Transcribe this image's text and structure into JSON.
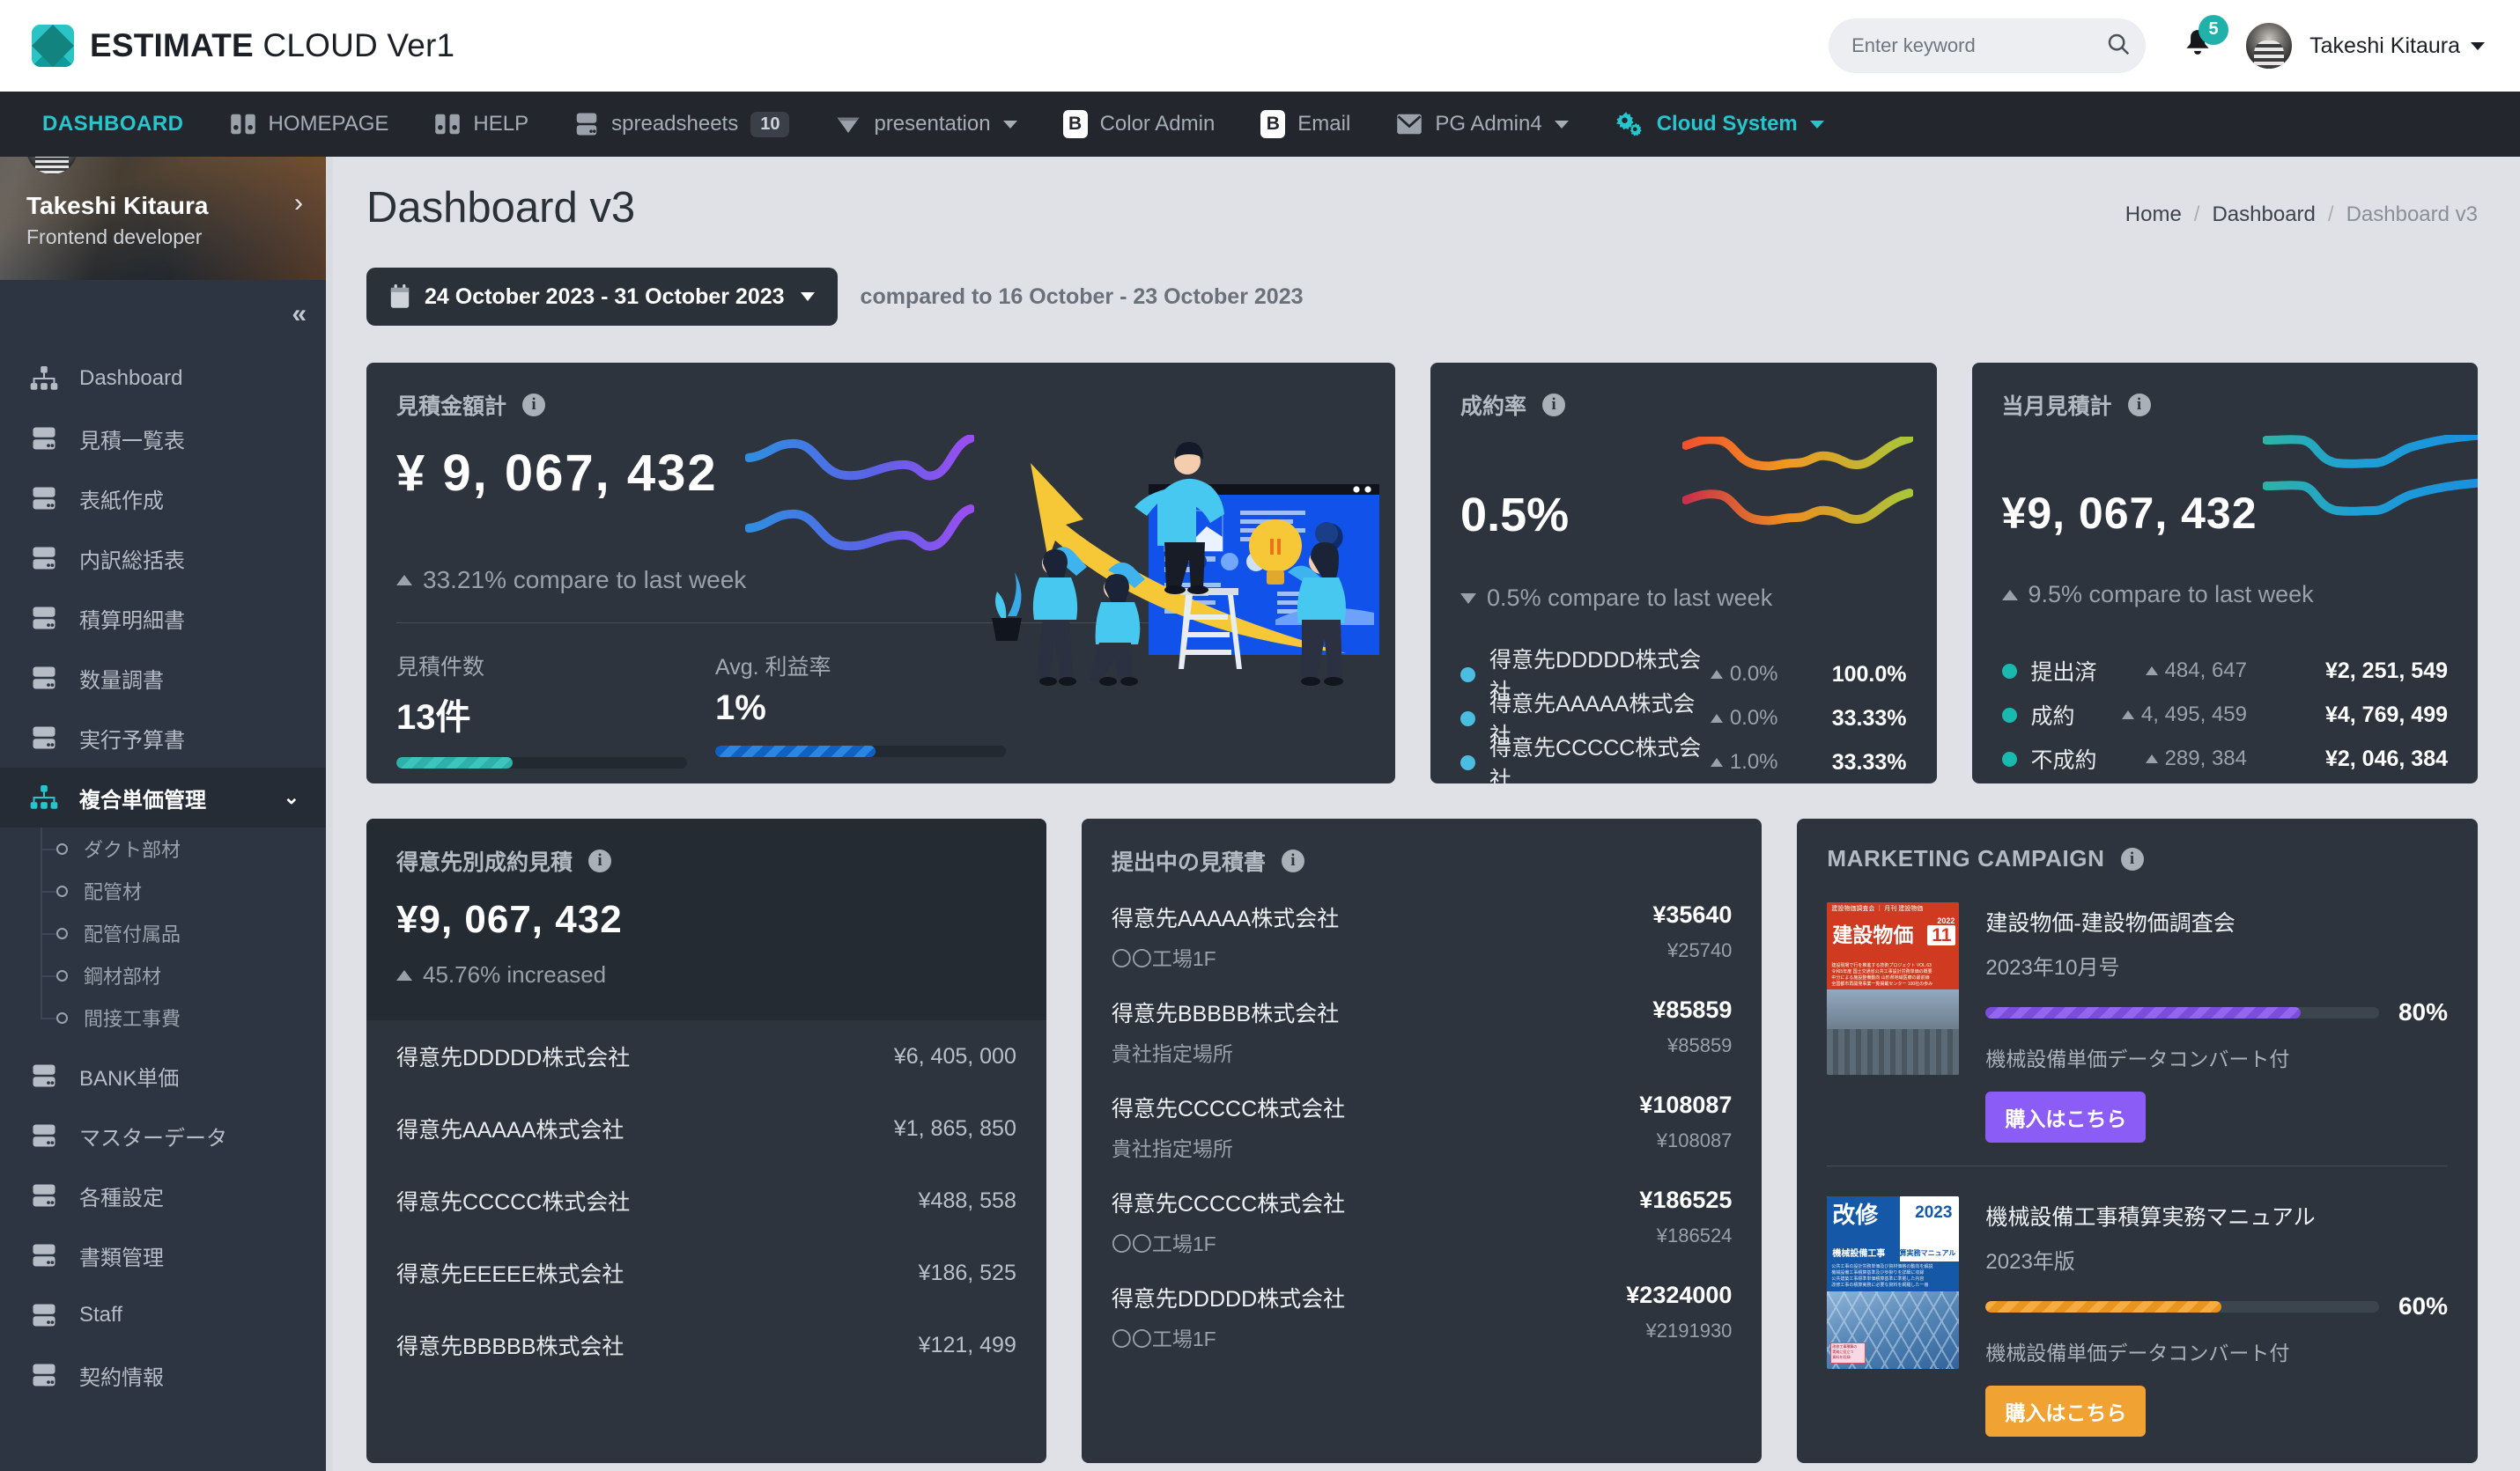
{
  "header": {
    "brand_bold": "ESTIMATE",
    "brand_light": " CLOUD Ver1",
    "search_placeholder": "Enter keyword",
    "search_value": "",
    "notification_count": "5",
    "username": "Takeshi Kitaura"
  },
  "nav": {
    "items": [
      {
        "label": "DASHBOARD",
        "icon": "none",
        "badge": "",
        "caret": false
      },
      {
        "label": "HOMEPAGE",
        "icon": "binary-icon",
        "badge": "",
        "caret": false
      },
      {
        "label": "HELP",
        "icon": "binary-icon",
        "badge": "",
        "caret": false
      },
      {
        "label": "spreadsheets",
        "icon": "server-icon",
        "badge": "10",
        "caret": false
      },
      {
        "label": "presentation",
        "icon": "diamond-icon",
        "badge": "",
        "caret": true
      },
      {
        "label": "Color Admin",
        "icon": "b-icon",
        "badge": "",
        "caret": false
      },
      {
        "label": "Email",
        "icon": "b-icon",
        "badge": "",
        "caret": false
      },
      {
        "label": "PG Admin4",
        "icon": "envelope-icon",
        "badge": "",
        "caret": true
      },
      {
        "label": "Cloud System",
        "icon": "gears-icon",
        "badge": "",
        "caret": true
      }
    ]
  },
  "sidebar": {
    "profile_name": "Takeshi Kitaura",
    "profile_role": "Frontend developer",
    "items": [
      {
        "label": "Dashboard",
        "icon": "sitemap-icon",
        "active": false
      },
      {
        "label": "見積一覧表",
        "icon": "server-icon",
        "active": false
      },
      {
        "label": "表紙作成",
        "icon": "server-icon",
        "active": false
      },
      {
        "label": "内訳総括表",
        "icon": "server-icon",
        "active": false
      },
      {
        "label": "積算明細書",
        "icon": "server-icon",
        "active": false
      },
      {
        "label": "数量調書",
        "icon": "server-icon",
        "active": false
      },
      {
        "label": "実行予算書",
        "icon": "server-icon",
        "active": false
      },
      {
        "label": "複合単価管理",
        "icon": "sitemap-icon",
        "active": true
      }
    ],
    "submenu": [
      "ダクト部材",
      "配管材",
      "配管付属品",
      "鋼材部材",
      "間接工事費"
    ],
    "items_after": [
      {
        "label": "BANK単価",
        "icon": "server-icon"
      },
      {
        "label": "マスターデータ",
        "icon": "server-icon"
      },
      {
        "label": "各種設定",
        "icon": "server-icon"
      },
      {
        "label": "書類管理",
        "icon": "server-icon"
      },
      {
        "label": "Staff",
        "icon": "server-icon"
      },
      {
        "label": "契約情報",
        "icon": "server-icon"
      }
    ]
  },
  "page": {
    "title": "Dashboard v3",
    "breadcrumb": [
      "Home",
      "Dashboard",
      "Dashboard v3"
    ],
    "date_range": "24 October 2023 - 31 October 2023",
    "compared_to": "compared to 16 October - 23 October 2023"
  },
  "card_estimate_total": {
    "title": "見積金額計",
    "value": "¥ 9, 067, 432",
    "compare": "33.21% compare to last week",
    "trend": "up",
    "stats": [
      {
        "label": "見積件数",
        "value": "13件",
        "progress": 40,
        "style": "teal"
      },
      {
        "label": "Avg. 利益率",
        "value": "1%",
        "progress": 55,
        "style": "blue"
      }
    ]
  },
  "card_conversion": {
    "title": "成約率",
    "value": "0.5%",
    "compare": "0.5% compare to last week",
    "trend": "down",
    "rows": [
      {
        "name": "得意先DDDDD株式会社",
        "delta": "0.0%",
        "value": "100.0%"
      },
      {
        "name": "得意先AAAAA株式会社",
        "delta": "0.0%",
        "value": "33.33%"
      },
      {
        "name": "得意先CCCCC株式会社",
        "delta": "1.0%",
        "value": "33.33%"
      }
    ]
  },
  "card_month_estimate": {
    "title": "当月見積計",
    "value": "¥9, 067, 432",
    "compare": "9.5% compare to last week",
    "trend": "up",
    "rows": [
      {
        "name": "提出済",
        "delta": "484, 647",
        "value": "¥2, 251, 549"
      },
      {
        "name": "成約",
        "delta": "4, 495, 459",
        "value": "¥4, 769, 499"
      },
      {
        "name": "不成約",
        "delta": "289, 384",
        "value": "¥2, 046, 384"
      }
    ]
  },
  "card_by_customer": {
    "title": "得意先別成約見積",
    "value": "¥9, 067, 432",
    "compare": "45.76% increased",
    "rows": [
      {
        "name": "得意先DDDDD株式会社",
        "amount": "¥6, 405, 000"
      },
      {
        "name": "得意先AAAAA株式会社",
        "amount": "¥1, 865, 850"
      },
      {
        "name": "得意先CCCCC株式会社",
        "amount": "¥488, 558"
      },
      {
        "name": "得意先EEEEE株式会社",
        "amount": "¥186, 525"
      },
      {
        "name": "得意先BBBBB株式会社",
        "amount": "¥121, 499"
      }
    ]
  },
  "card_submitted": {
    "title": "提出中の見積書",
    "rows": [
      {
        "name": "得意先AAAAA株式会社",
        "place": "〇〇工場1F",
        "amount": "¥35640",
        "sub_amount": "¥25740"
      },
      {
        "name": "得意先BBBBB株式会社",
        "place": "貴社指定場所",
        "amount": "¥85859",
        "sub_amount": "¥85859"
      },
      {
        "name": "得意先CCCCC株式会社",
        "place": "貴社指定場所",
        "amount": "¥108087",
        "sub_amount": "¥108087"
      },
      {
        "name": "得意先CCCCC株式会社",
        "place": "〇〇工場1F",
        "amount": "¥186525",
        "sub_amount": "¥186524"
      },
      {
        "name": "得意先DDDDD株式会社",
        "place": "〇〇工場1F",
        "amount": "¥2324000",
        "sub_amount": "¥2191930"
      }
    ]
  },
  "card_marketing": {
    "title": "MARKETING CAMPAIGN",
    "promos": [
      {
        "cover_title": "建設物価",
        "cover_year": "2022",
        "cover_issue": "11",
        "title": "建設物価-建設物価調査会",
        "subtitle": "2023年10月号",
        "progress": "80%",
        "progress_value": 80,
        "note": "機械設備単価データコンバート付",
        "button": "購入はこちら",
        "color": "#8b5cf6",
        "style": "purple"
      },
      {
        "cover_title": "改修",
        "cover_year": "2023",
        "cover_issue": "機械設備工事",
        "title": "機械設備工事積算実務マニュアル",
        "subtitle": "2023年版",
        "progress": "60%",
        "progress_value": 60,
        "note": "機械設備単価データコンバート付",
        "button": "購入はこちら",
        "color": "#f0a232",
        "style": "orange"
      }
    ]
  },
  "colors": {
    "accent_teal": "#25c6cd",
    "card_bg": "#2d343d",
    "page_bg": "#dfe1e6",
    "sidebar_bg": "#2d3542",
    "navbar_bg": "#23272d"
  }
}
